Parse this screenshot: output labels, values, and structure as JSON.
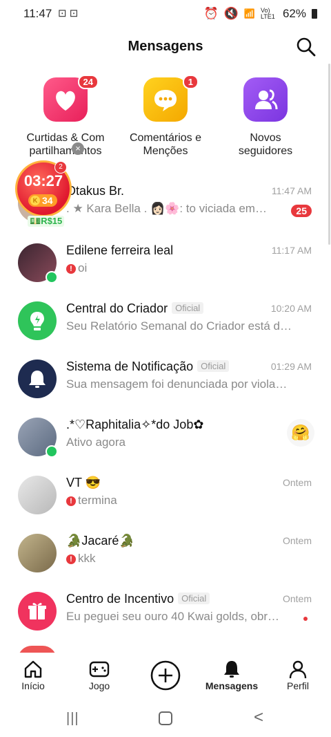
{
  "status": {
    "time": "11:47",
    "left_icons": "⊡ ⊡",
    "battery": "62%",
    "network": "Vo) LTE1"
  },
  "header": {
    "title": "Mensagens"
  },
  "shortcuts": [
    {
      "label_line1": "Curtidas & Com",
      "label_line2": "partilhamentos",
      "badge": "24",
      "color": "#f0386b"
    },
    {
      "label_line1": "Comentários e",
      "label_line2": "Menções",
      "badge": "1",
      "color": "#f7b500"
    },
    {
      "label_line1": "Novos",
      "label_line2": "seguidores",
      "badge": "",
      "color": "#8f45e8"
    }
  ],
  "timer": {
    "time": "03:27",
    "coins": "34",
    "badge": "2",
    "reward": "R$15",
    "coin_letter": "K"
  },
  "conversations": [
    {
      "name": "Otakus Br.",
      "preview": ". ★ Kara  Bella . 👩🏻🌸: to viciada em…",
      "time": "11:47 AM",
      "count": "25"
    },
    {
      "name": "Edilene ferreira leal",
      "preview": "oi",
      "time": "11:17 AM",
      "alert": "!"
    },
    {
      "name": "Central do Criador",
      "tag": "Oficial",
      "preview": "Seu Relatório Semanal do Criador está d…",
      "time": "10:20 AM"
    },
    {
      "name": "Sistema de Notificação",
      "tag": "Oficial",
      "preview": "Sua mensagem foi denunciada por viola…",
      "time": "01:29 AM"
    },
    {
      "name": ".*♡Raphitalia✧*do Job✿",
      "preview": "Ativo agora",
      "time": "",
      "emoji": "🤗"
    },
    {
      "name": "VT 😎",
      "preview": "termina",
      "time": "Ontem",
      "alert": "!"
    },
    {
      "name": "🐊Jacaré🐊",
      "preview": "kkk",
      "time": "Ontem",
      "alert": "!"
    },
    {
      "name": "Centro de Incentivo",
      "tag": "Oficial",
      "preview": "Eu peguei seu ouro 40 Kwai golds, obr…",
      "time": "Ontem"
    }
  ],
  "nav": [
    {
      "label": "Início",
      "icon": "home-icon"
    },
    {
      "label": "Jogo",
      "icon": "gamepad-icon"
    },
    {
      "label": "",
      "icon": "plus-icon"
    },
    {
      "label": "Mensagens",
      "icon": "bell-icon"
    },
    {
      "label": "Perfil",
      "icon": "profile-icon"
    }
  ],
  "sysnav": {
    "recent": "|||",
    "home": "○",
    "back": "<"
  }
}
